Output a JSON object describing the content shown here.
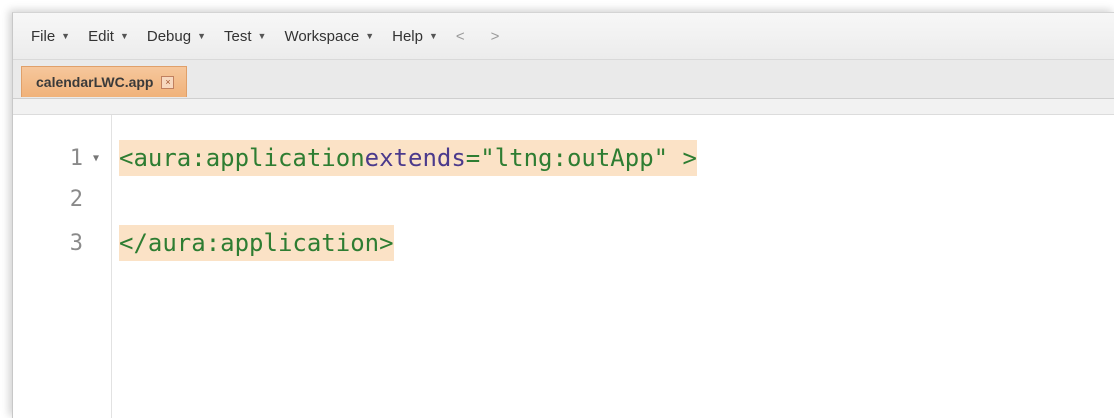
{
  "menu": {
    "items": [
      {
        "label": "File"
      },
      {
        "label": "Edit"
      },
      {
        "label": "Debug"
      },
      {
        "label": "Test"
      },
      {
        "label": "Workspace"
      },
      {
        "label": "Help"
      }
    ],
    "back": "<",
    "forward": ">"
  },
  "tab": {
    "label": "calendarLWC.app",
    "close": "×"
  },
  "editor": {
    "lines": [
      {
        "number": "1",
        "tag_open": "<aura:application",
        "attr": "extends",
        "eq": "=",
        "value": "\"ltng:outApp\"",
        "close": " >"
      },
      {
        "number": "2"
      },
      {
        "number": "3",
        "tag_close": "</aura:application>"
      }
    ]
  },
  "colors": {
    "tab_background": "#f0b27a",
    "highlight": "#fbe2c6",
    "tag": "#2e7d32",
    "attribute": "#4b3a8c"
  }
}
